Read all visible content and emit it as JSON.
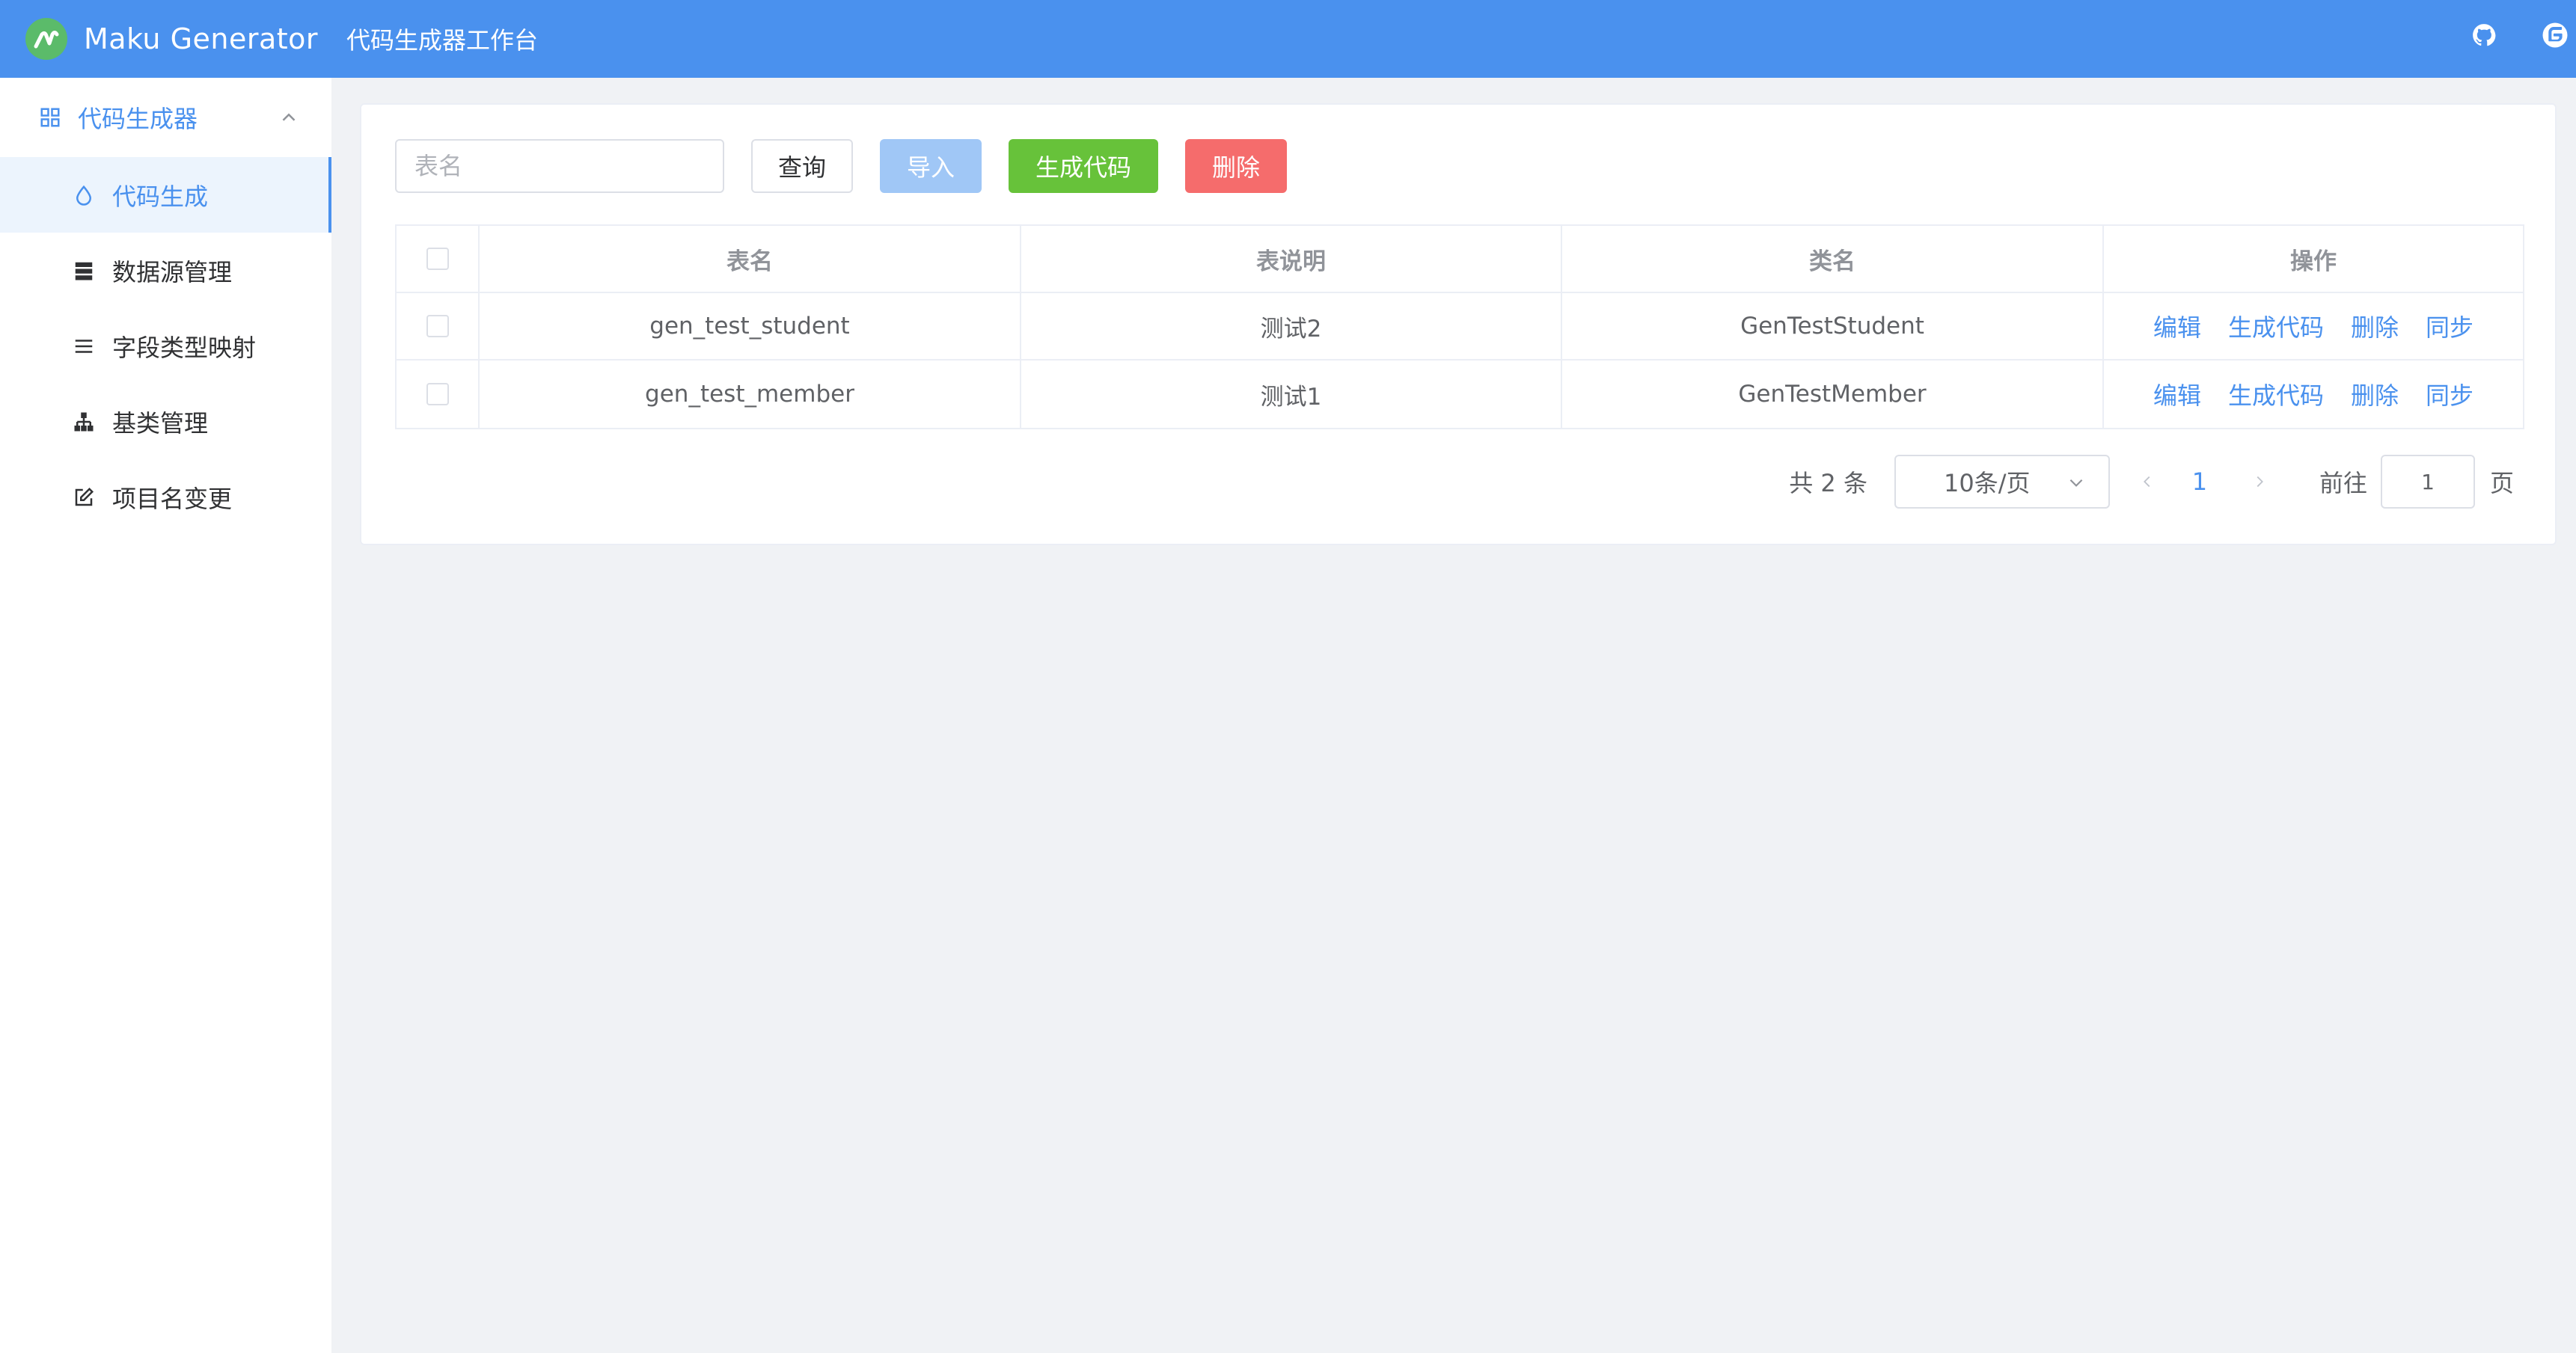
{
  "header": {
    "app_title": "Maku Generator",
    "workspace_title": "代码生成器工作台",
    "icons": [
      "github-icon",
      "gitee-icon"
    ]
  },
  "sidebar": {
    "group": {
      "label": "代码生成器",
      "icon": "grid-icon",
      "expanded": true
    },
    "items": [
      {
        "label": "代码生成",
        "icon": "drop-icon",
        "active": true
      },
      {
        "label": "数据源管理",
        "icon": "database-icon",
        "active": false
      },
      {
        "label": "字段类型映射",
        "icon": "list-icon",
        "active": false
      },
      {
        "label": "基类管理",
        "icon": "hierarchy-icon",
        "active": false
      },
      {
        "label": "项目名变更",
        "icon": "edit-icon",
        "active": false
      }
    ]
  },
  "toolbar": {
    "search_placeholder": "表名",
    "search_value": "",
    "query_label": "查询",
    "import_label": "导入",
    "generate_label": "生成代码",
    "delete_label": "删除"
  },
  "table": {
    "columns": [
      "表名",
      "表说明",
      "类名",
      "操作"
    ],
    "rows": [
      {
        "table_name": "gen_test_student",
        "comment": "测试2",
        "class_name": "GenTestStudent"
      },
      {
        "table_name": "gen_test_member",
        "comment": "测试1",
        "class_name": "GenTestMember"
      }
    ],
    "actions": [
      "编辑",
      "生成代码",
      "删除",
      "同步"
    ]
  },
  "pagination": {
    "total_text": "共 2 条",
    "page_size": "10条/页",
    "current_page": "1",
    "goto_label": "前往",
    "goto_value": "1",
    "page_suffix": "页"
  },
  "colors": {
    "header_bg": "#4a91ee",
    "accent": "#4a91ee",
    "success": "#67c23a",
    "danger": "#f56c6c",
    "import_disabled": "#a0c7f6"
  }
}
